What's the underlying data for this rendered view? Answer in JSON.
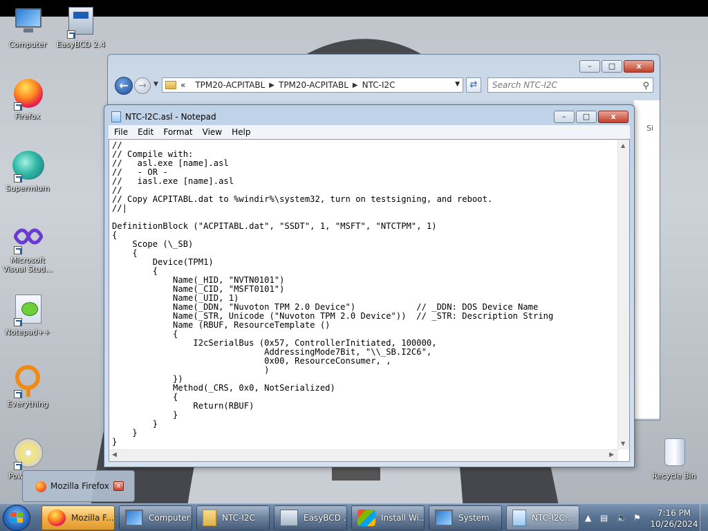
{
  "desktop": {
    "icons": [
      {
        "label": "Computer"
      },
      {
        "label": "EasyBCD 2.4"
      },
      {
        "label": "Firefox"
      },
      {
        "label": "Supermium"
      },
      {
        "label": "Microsoft Visual Stud..."
      },
      {
        "label": "Notepad++"
      },
      {
        "label": "Everything"
      },
      {
        "label": "Pow"
      },
      {
        "label": "Recycle Bin"
      }
    ]
  },
  "explorer": {
    "breadcrumb": [
      "«",
      "TPM20-ACPITABL",
      "TPM20-ACPITABL",
      "NTC-I2C"
    ],
    "search_placeholder": "Search NTC-I2C",
    "column_header": "Si",
    "buttons": {
      "minimize": "–",
      "maximize": "□",
      "close": "x"
    }
  },
  "notepad": {
    "title": "NTC-I2C.asl - Notepad",
    "menus": [
      "File",
      "Edit",
      "Format",
      "View",
      "Help"
    ],
    "buttons": {
      "minimize": "–",
      "maximize": "□",
      "close": "x"
    },
    "content": "//\n// Compile with:\n//   asl.exe [name].asl\n//   - OR -\n//   iasl.exe [name].asl\n//\n// Copy ACPITABL.dat to %windir%\\system32, turn on testsigning, and reboot.\n//|\n\nDefinitionBlock (\"ACPITABL.dat\", \"SSDT\", 1, \"MSFT\", \"NTCTPM\", 1)\n{\n    Scope (\\_SB)\n    {\n        Device(TPM1)\n        {\n            Name(_HID, \"NVTN0101\")\n            Name(_CID, \"MSFT0101\")\n            Name(_UID, 1)\n            Name(_DDN, \"Nuvoton TPM 2.0 Device\")            // _DDN: DOS Device Name\n            Name(_STR, Unicode (\"Nuvoton TPM 2.0 Device\"))  // _STR: Description String\n            Name (RBUF, ResourceTemplate ()\n            {\n                I2cSerialBus (0x57, ControllerInitiated, 100000,\n                              AddressingMode7Bit, \"\\\\_SB.I2C6\",\n                              0x00, ResourceConsumer, ,\n                              )\n            })\n            Method(_CRS, 0x0, NotSerialized)\n            {\n                Return(RBUF)\n            }\n        }\n    }\n}"
  },
  "popup": {
    "label": "Mozilla Firefox",
    "close": "x"
  },
  "taskbar": {
    "buttons": [
      {
        "label": "Mozilla F...",
        "active": true
      },
      {
        "label": "Computer",
        "active": false
      },
      {
        "label": "NTC-I2C",
        "active": false
      },
      {
        "label": "EasyBCD ...",
        "active": false
      },
      {
        "label": "Install Wi...",
        "active": false
      },
      {
        "label": "System",
        "active": false
      },
      {
        "label": "NTC-I2C...",
        "active": false
      }
    ],
    "clock": {
      "time": "7:16 PM",
      "date": "10/26/2024"
    }
  },
  "colors": {
    "taskbar_active": "#f3b34a",
    "window_frame": "#bfd2e8",
    "close_button": "#c2402a"
  }
}
